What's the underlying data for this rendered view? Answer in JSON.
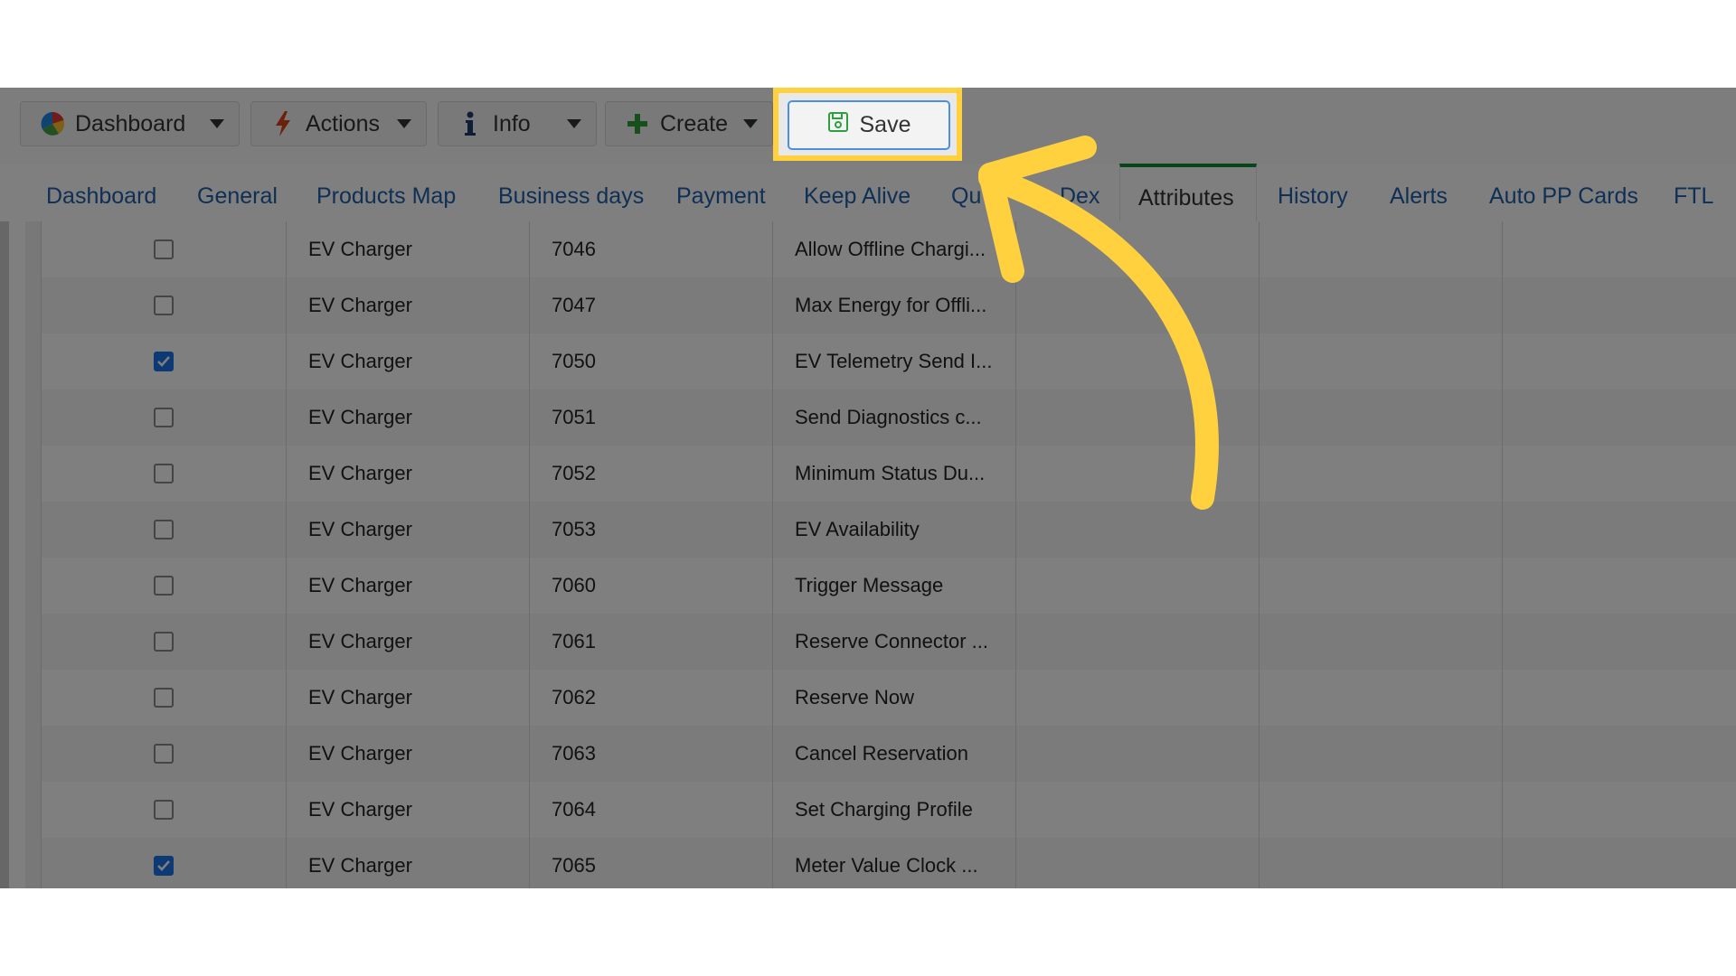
{
  "toolbar": {
    "dashboard_label": "Dashboard",
    "actions_label": "Actions",
    "info_label": "Info",
    "create_label": "Create",
    "save_label": "Save"
  },
  "tabs": [
    {
      "label": "Dashboard"
    },
    {
      "label": "General"
    },
    {
      "label": "Products Map"
    },
    {
      "label": "Business days"
    },
    {
      "label": "Payment"
    },
    {
      "label": "Keep Alive"
    },
    {
      "label": "Qu"
    },
    {
      "label": "Dex"
    },
    {
      "label": "Attributes"
    },
    {
      "label": "History"
    },
    {
      "label": "Alerts"
    },
    {
      "label": "Auto PP Cards"
    },
    {
      "label": "FTL"
    }
  ],
  "active_tab": "Attributes",
  "rows": [
    {
      "checked": false,
      "type": "EV Charger",
      "id": "7046",
      "name": "Allow Offline Chargi..."
    },
    {
      "checked": false,
      "type": "EV Charger",
      "id": "7047",
      "name": "Max Energy for Offli..."
    },
    {
      "checked": true,
      "type": "EV Charger",
      "id": "7050",
      "name": "EV Telemetry Send I..."
    },
    {
      "checked": false,
      "type": "EV Charger",
      "id": "7051",
      "name": "Send Diagnostics c..."
    },
    {
      "checked": false,
      "type": "EV Charger",
      "id": "7052",
      "name": "Minimum Status Du..."
    },
    {
      "checked": false,
      "type": "EV Charger",
      "id": "7053",
      "name": "EV Availability"
    },
    {
      "checked": false,
      "type": "EV Charger",
      "id": "7060",
      "name": "Trigger Message"
    },
    {
      "checked": false,
      "type": "EV Charger",
      "id": "7061",
      "name": "Reserve Connector ..."
    },
    {
      "checked": false,
      "type": "EV Charger",
      "id": "7062",
      "name": "Reserve Now"
    },
    {
      "checked": false,
      "type": "EV Charger",
      "id": "7063",
      "name": "Cancel Reservation"
    },
    {
      "checked": false,
      "type": "EV Charger",
      "id": "7064",
      "name": "Set Charging Profile"
    },
    {
      "checked": true,
      "type": "EV Charger",
      "id": "7065",
      "name": "Meter Value Clock ..."
    }
  ],
  "colors": {
    "highlight": "#ffd13f",
    "arrow": "#ffd13f",
    "tab_link": "#1e5fa8",
    "active_tab_bar": "#138a36",
    "save_border": "#4a90e2",
    "checkbox_on": "#1a73e8"
  },
  "icons": {
    "dashboard": "pie-chart-icon",
    "actions": "lightning-icon",
    "info": "info-icon",
    "create": "plus-icon",
    "save": "floppy-disk-icon"
  }
}
